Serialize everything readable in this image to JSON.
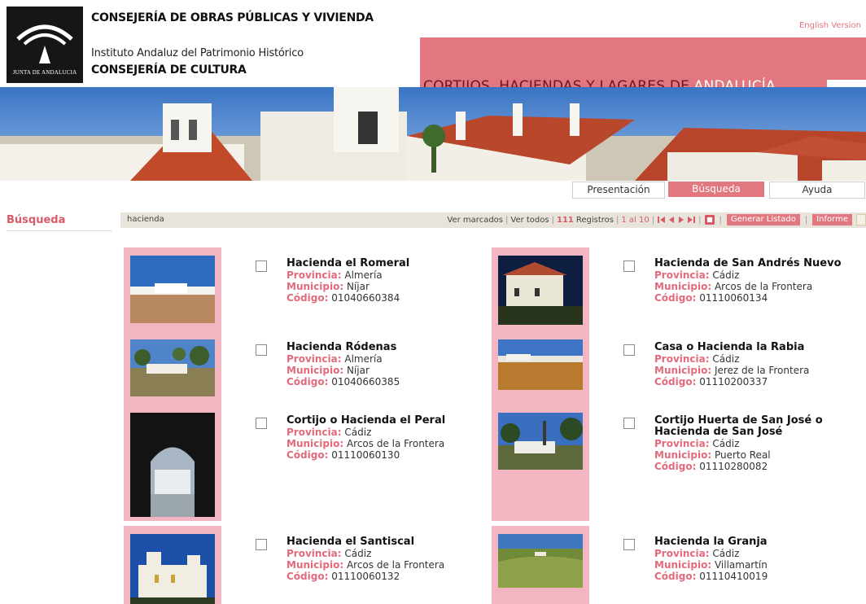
{
  "header": {
    "logo_text": "JUNTA DE ANDALUCIA",
    "line1": "CONSEJERÍA DE OBRAS PÚBLICAS Y VIVIENDA",
    "line2": "Instituto Andaluz del Patrimonio Histórico",
    "line3": "CONSEJERÍA DE CULTURA",
    "english_link": "English Version",
    "banner_title_main": "CORTIJOS, HACIENDAS Y LAGARES DE ",
    "banner_title_accent": "ANDALUCÍA"
  },
  "tabs": [
    "Presentación",
    "Búsqueda",
    "Ayuda"
  ],
  "search": {
    "label": "Búsqueda",
    "term": "hacienda",
    "ver_marcados": "Ver marcados",
    "ver_todos": "Ver todos",
    "count": "111",
    "count_label": "Registros",
    "range": "1 al 10",
    "generar_label": "Generar Listado",
    "informe_label": "Informe"
  },
  "labels": {
    "provincia": "Provincia:",
    "municipio": "Municipio:",
    "codigo": "Código:"
  },
  "results": [
    {
      "title": "Hacienda el Romeral",
      "provincia": "Almería",
      "municipio": "Níjar",
      "codigo": "01040660384"
    },
    {
      "title": "Hacienda de San Andrés Nuevo",
      "provincia": "Cádiz",
      "municipio": "Arcos de la Frontera",
      "codigo": "01110060134"
    },
    {
      "title": "Hacienda Ródenas",
      "provincia": "Almería",
      "municipio": "Níjar",
      "codigo": "01040660385"
    },
    {
      "title": "Casa o Hacienda la Rabia",
      "provincia": "Cádiz",
      "municipio": "Jerez de la Frontera",
      "codigo": "01110200337"
    },
    {
      "title": "Cortijo o Hacienda el Peral",
      "provincia": "Cádiz",
      "municipio": "Arcos de la Frontera",
      "codigo": "01110060130"
    },
    {
      "title": "Cortijo Huerta de San José o Hacienda de San José",
      "provincia": "Cádiz",
      "municipio": "Puerto Real",
      "codigo": "01110280082"
    },
    {
      "title": "Hacienda el Santiscal",
      "provincia": "Cádiz",
      "municipio": "Arcos de la Frontera",
      "codigo": "01110060132"
    },
    {
      "title": "Hacienda la Granja",
      "provincia": "Cádiz",
      "municipio": "Villamartín",
      "codigo": "01110410019"
    }
  ]
}
